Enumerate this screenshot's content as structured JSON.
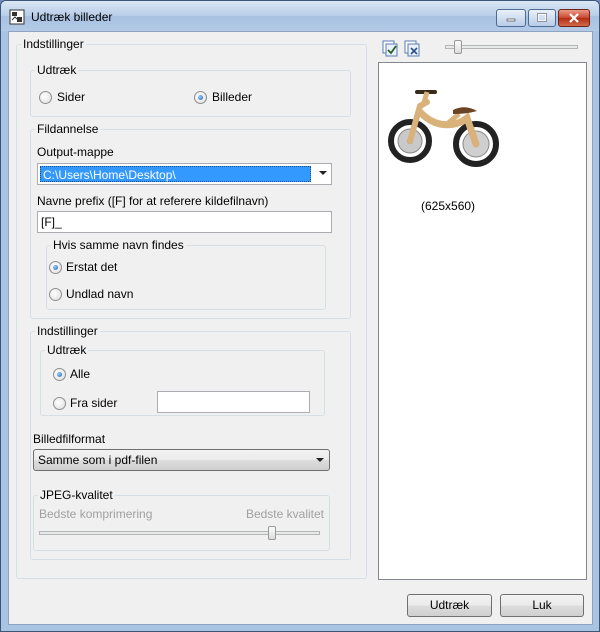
{
  "window": {
    "title": "Udtræk billeder",
    "icon": "extract-images-app-icon",
    "controls": [
      "minimize-icon",
      "maximize-icon",
      "close-icon"
    ]
  },
  "settings_panel": {
    "legend": "Indstillinger",
    "extract_group": {
      "legend": "Udtræk",
      "options": [
        {
          "label": "Sider",
          "selected": false
        },
        {
          "label": "Billeder",
          "selected": true
        }
      ]
    },
    "file_group": {
      "legend": "Fildannelse",
      "output_label": "Output-mappe",
      "output_value": "C:\\Users\\Home\\Desktop\\",
      "prefix_label": "Navne prefix ([F] for at referere kildefilnavn)",
      "prefix_value": "[F]_",
      "same_name_group": {
        "legend": "Hvis samme navn findes",
        "options": [
          {
            "label": "Erstat det",
            "selected": true
          },
          {
            "label": "Undlad navn",
            "selected": false
          }
        ]
      }
    },
    "settings_group": {
      "legend": "Indstillinger",
      "extract_group": {
        "legend": "Udtræk",
        "options": [
          {
            "label": "Alle",
            "selected": true
          },
          {
            "label": "Fra sider",
            "selected": false
          }
        ],
        "pages_value": ""
      },
      "format_label": "Billedfilformat",
      "format_value": "Samme som i pdf-filen",
      "jpeg_group": {
        "legend": "JPEG-kvalitet",
        "min_label": "Bedste komprimering",
        "max_label": "Bedste kvalitet",
        "quality_fraction": 0.83,
        "enabled": false
      }
    }
  },
  "preview": {
    "toolbar_icons": [
      "select-all-icon",
      "deselect-all-icon"
    ],
    "zoom_fraction": 0.1,
    "thumbnail": {
      "subject": "wooden balance bike",
      "caption": "(625x560)"
    }
  },
  "buttons": {
    "extract_label": "Udtræk",
    "close_label": "Luk"
  },
  "colors": {
    "selection": "#3399ff",
    "frame": "#a9c3e3",
    "close_button": "#c8452e"
  }
}
